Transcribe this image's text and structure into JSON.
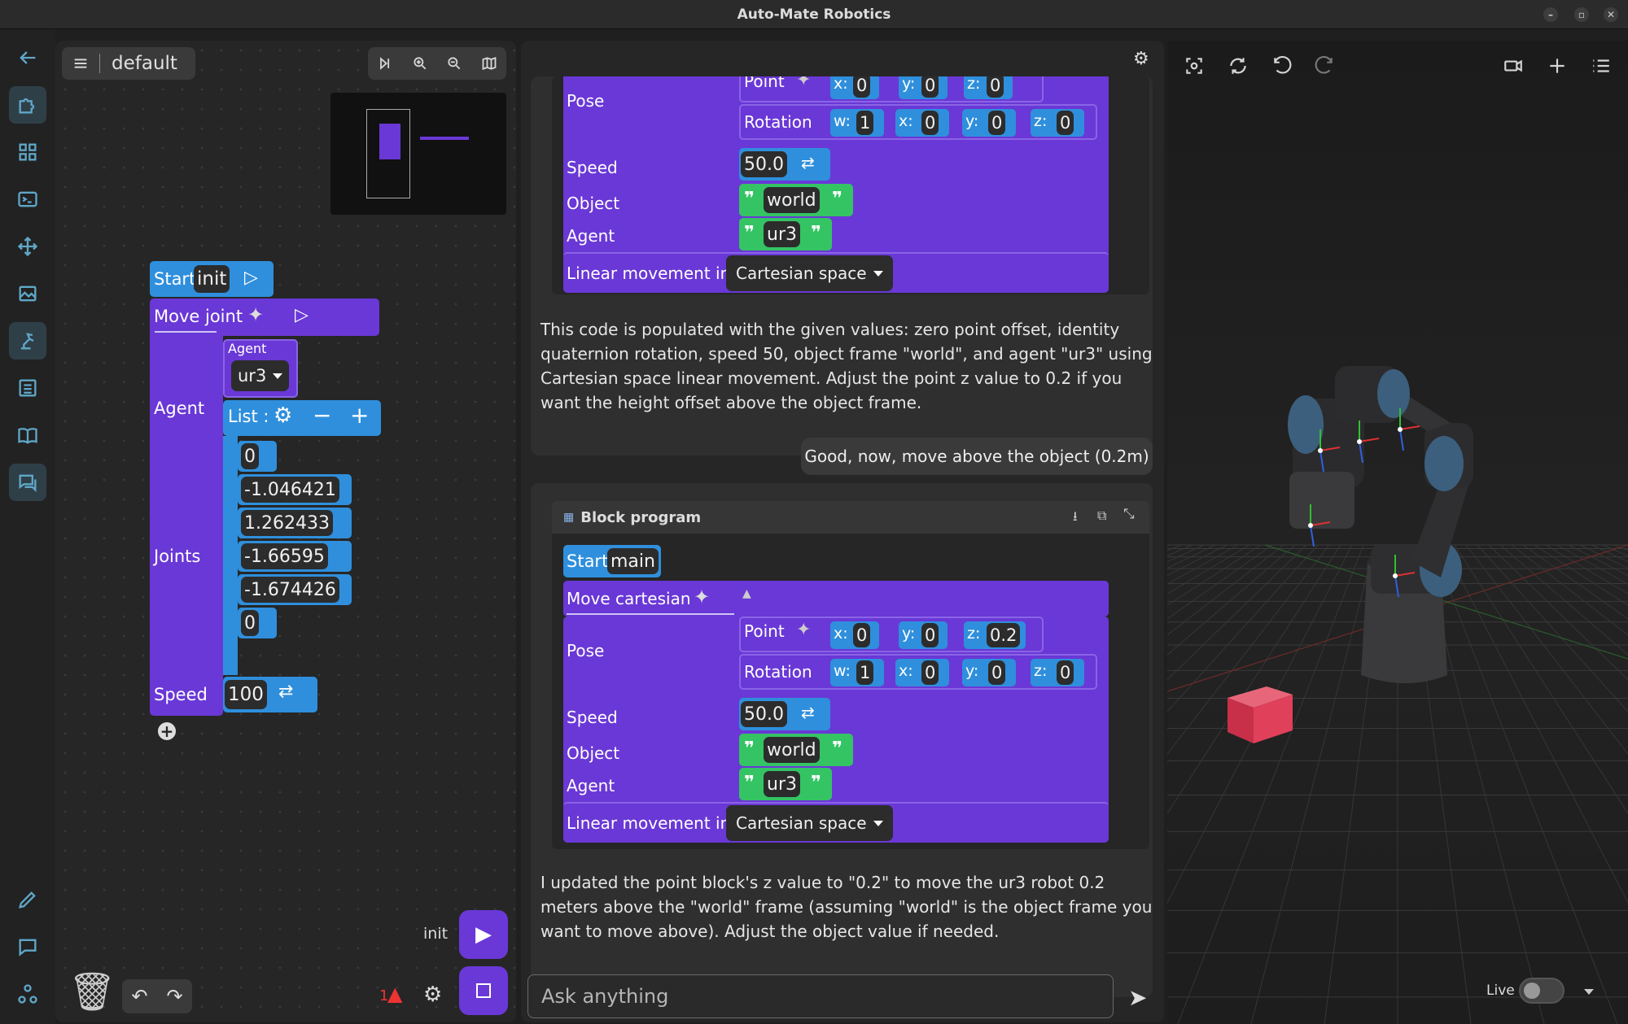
{
  "window": {
    "title": "Auto-Mate Robotics"
  },
  "workspace": {
    "name": "default",
    "run_label": "init",
    "warning_count": "1",
    "start": {
      "label": "Start",
      "name": "init"
    },
    "move_joint": {
      "label": "Move joint",
      "agent_label": "Agent",
      "agent_header": "Agent",
      "agent_value": "ur3",
      "joints_label": "Joints",
      "list_label": "List :",
      "joints": [
        "0",
        "-1.046421",
        "1.262433",
        "-1.66595",
        "-1.674426",
        "0"
      ],
      "speed_label": "Speed",
      "speed_value": "100"
    }
  },
  "chat": {
    "top_block": {
      "pose_label": "Pose",
      "point_label": "Point",
      "rotation_label": "Rotation",
      "px": "0",
      "py": "0",
      "pz": "0",
      "rw": "1",
      "rx": "0",
      "ry": "0",
      "rz": "0",
      "speed_label": "Speed",
      "speed": "50.0",
      "object_label": "Object",
      "object": "world",
      "agent_label": "Agent",
      "agent": "ur3",
      "linear_label": "Linear movement in",
      "linear_value": "Cartesian space"
    },
    "assistant_msg_1": [
      "This code is populated with the given values: zero point offset, identity",
      "quaternion rotation, speed 50, object frame \"world\", and agent \"ur3\" using",
      "Cartesian space linear movement. Adjust the point z value to 0.2 if you",
      "want the height offset above the object frame."
    ],
    "user_msg": "Good, now, move above the object (0.2m)",
    "block_program": {
      "title": "Block program",
      "start_label": "Start",
      "start_name": "main",
      "move_label": "Move cartesian",
      "pose_label": "Pose",
      "point_label": "Point",
      "rotation_label": "Rotation",
      "px": "0",
      "py": "0",
      "pz": "0.2",
      "rw": "1",
      "rx": "0",
      "ry": "0",
      "rz": "0",
      "speed_label": "Speed",
      "speed": "50.0",
      "object_label": "Object",
      "object": "world",
      "agent_label": "Agent",
      "agent": "ur3",
      "linear_label": "Linear movement in",
      "linear_value": "Cartesian space"
    },
    "assistant_msg_2": [
      "I updated the point block's z value to \"0.2\" to move the ur3 robot 0.2",
      "meters above the \"world\" frame (assuming \"world\" is the object frame you",
      "want to move above). Adjust the object value if needed."
    ],
    "input_placeholder": "Ask anything"
  },
  "viewport": {
    "live_label": "Live"
  },
  "axis_labels": {
    "x": "x:",
    "y": "y:",
    "z": "z:",
    "w": "w:"
  }
}
